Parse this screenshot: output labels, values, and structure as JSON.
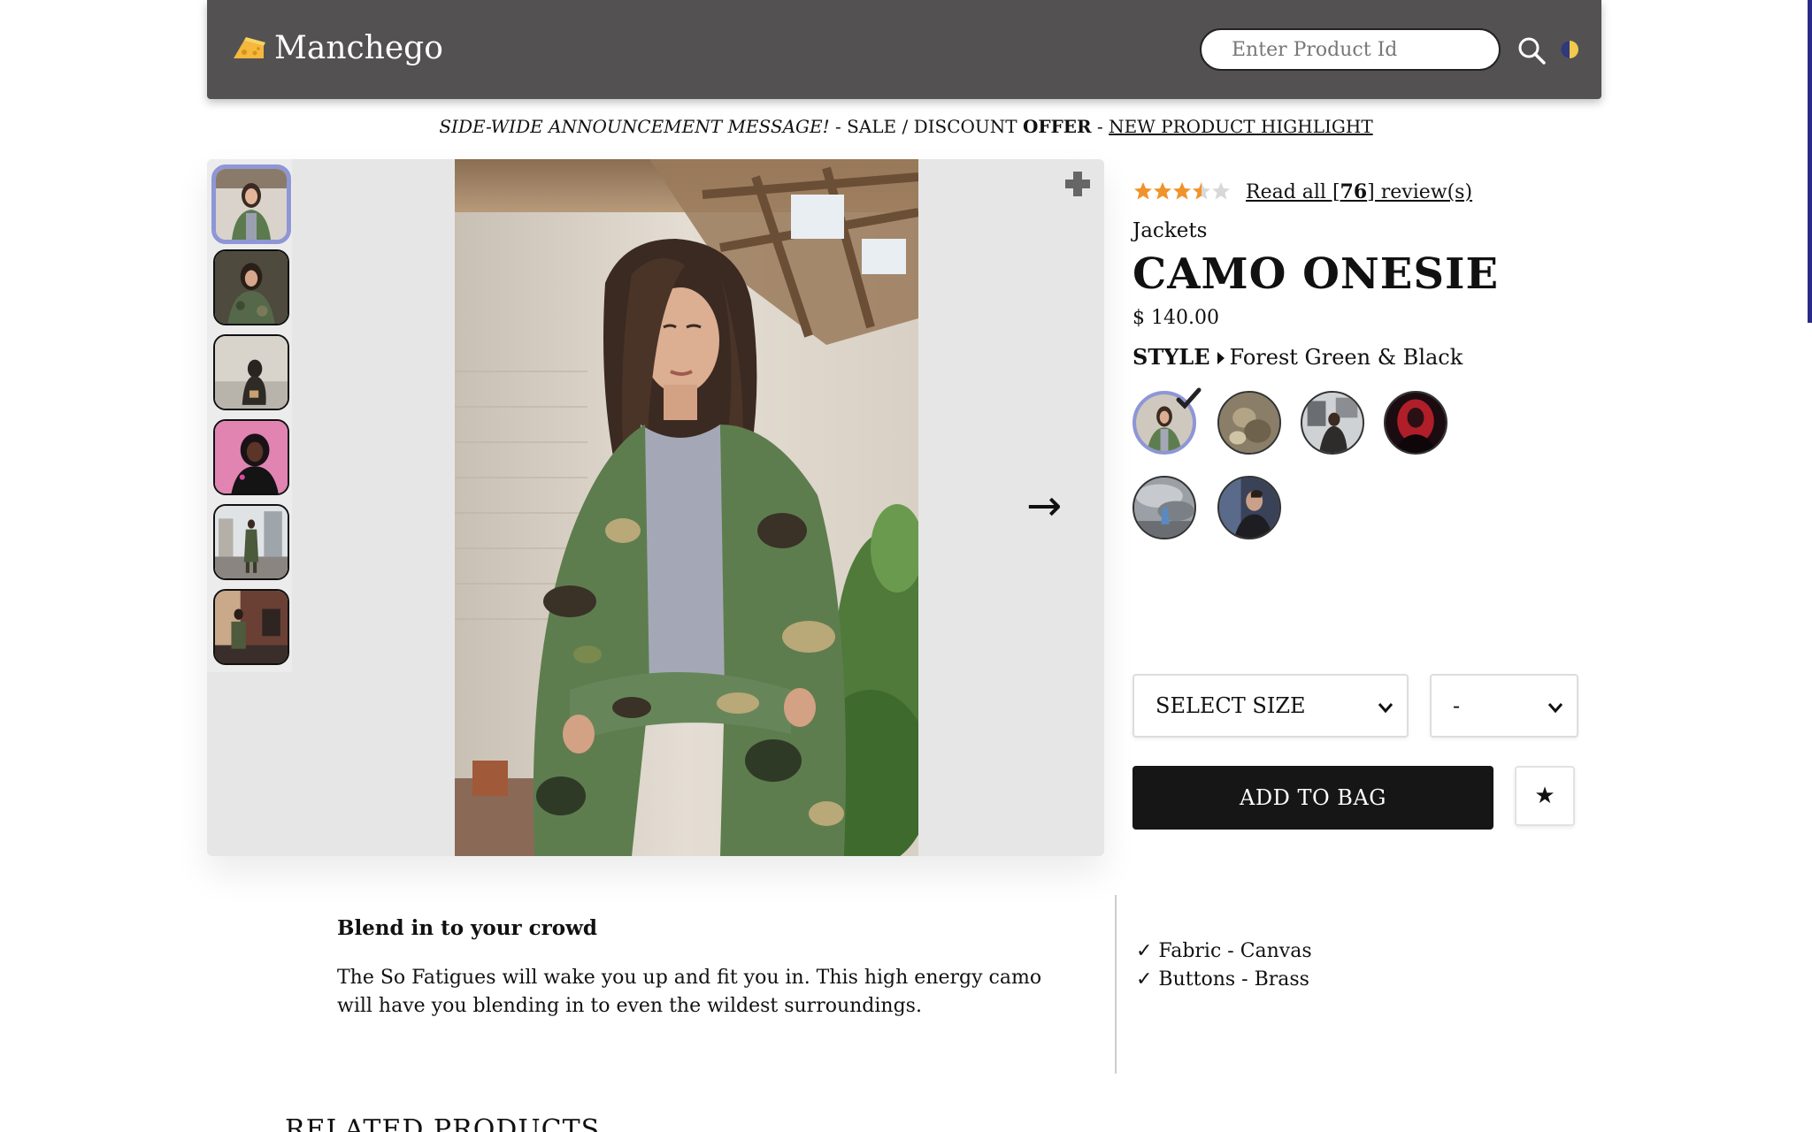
{
  "header": {
    "brand": "Manchego",
    "search_placeholder": "Enter Product Id"
  },
  "announcement": {
    "italic": "SIDE-WIDE ANNOUNCEMENT MESSAGE!",
    "sep1": " - SALE / DISCOUNT ",
    "offer": "OFFER",
    "sep2": " - ",
    "link": "NEW PRODUCT HIGHLIGHT"
  },
  "product": {
    "rating": 3.5,
    "rating_max": 5,
    "reviews_prefix": "Read all [",
    "reviews_count": "76",
    "reviews_suffix": "] review(s)",
    "category": "Jackets",
    "name": "CAMO ONESIE",
    "price": "$ 140.00",
    "style_label": "STYLE",
    "style_value": "Forest Green & Black",
    "size_select": "SELECT SIZE",
    "qty_select": "-",
    "add_to_bag": "ADD TO BAG",
    "favorite_glyph": "★"
  },
  "gallery": {
    "thumbnail_count": 6,
    "selected_index": 0,
    "next_arrow": "→"
  },
  "description": {
    "heading": "Blend in to your crowd",
    "body": "The So Fatigues will wake you up and fit you in. This high energy camo will have you blending in to even the wildest surroundings.",
    "features": [
      "✓ Fabric - Canvas",
      "✓ Buttons - Brass"
    ]
  },
  "related": {
    "heading": "RELATED PRODUCTS"
  },
  "colors": {
    "header_bg": "#535152",
    "accent": "#8e96d6",
    "star": "#f0932b",
    "button_bg": "#161616"
  }
}
